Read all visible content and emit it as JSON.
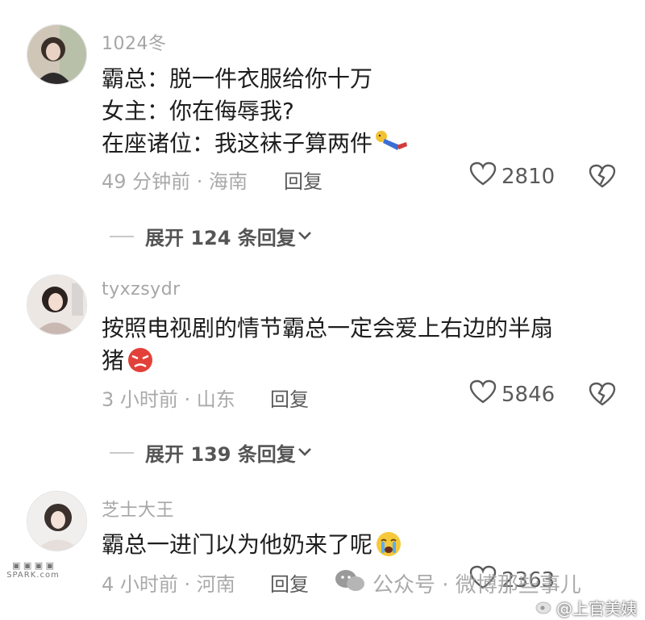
{
  "comments": [
    {
      "username": "1024冬",
      "lines": [
        "霸总：脱一件衣服给你十万",
        "女主：你在侮辱我?",
        "在座诸位：我这袜子算两件"
      ],
      "time_location": "49 分钟前 · 海南",
      "reply_label": "回复",
      "likes": "2810",
      "expand_label": "展开 124 条回复"
    },
    {
      "username": "tyxzsydr",
      "lines": [
        "按照电视剧的情节霸总一定会爱上右边的半扇",
        "猪"
      ],
      "time_location": "3 小时前 · 山东",
      "reply_label": "回复",
      "likes": "5846",
      "expand_label": "展开 139 条回复"
    },
    {
      "username": "芝士大王",
      "lines": [
        "霸总一进门以为他奶来了呢"
      ],
      "time_location": "4 小时前 · 河南",
      "reply_label": "回复",
      "likes": "2363"
    }
  ],
  "icons": {
    "like": "heart-outline-icon",
    "dislike": "broken-heart-icon",
    "expand": "chevron-down-icon"
  },
  "watermarks": {
    "wechat": "公众号 · 微博那些事儿",
    "weibo": "@上官美姨",
    "site_small": "SPARK.com"
  },
  "colors": {
    "username": "#a6a6a6",
    "meta": "#a9a9a9",
    "text": "#1e1e1e"
  }
}
